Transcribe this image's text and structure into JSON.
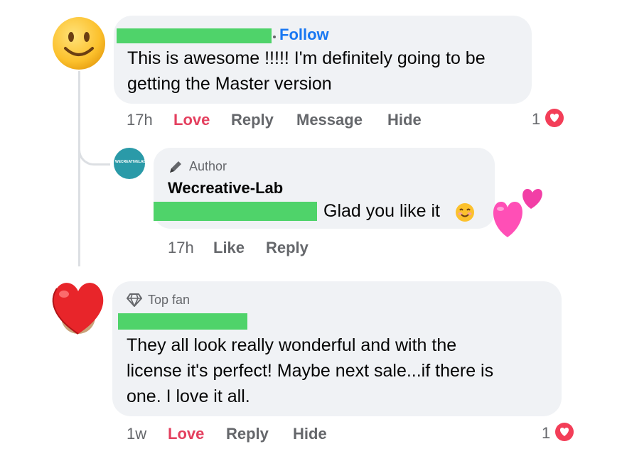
{
  "comment1": {
    "follow_label": "Follow",
    "text_line1": "This is awesome !!!!! I'm definitely going to be",
    "text_line2": "getting the Master version",
    "time": "17h",
    "love": "Love",
    "reply": "Reply",
    "message": "Message",
    "hide": "Hide",
    "reaction_count": "1"
  },
  "reply1": {
    "avatar_text": "WECREATIVELAB",
    "badge": "Author",
    "author": "Wecreative-Lab",
    "text": "Glad you like it",
    "time": "17h",
    "like": "Like",
    "reply": "Reply"
  },
  "comment2": {
    "badge": "Top fan",
    "text_line1": "They all look really wonderful and with the",
    "text_line2": "license it's perfect!  Maybe next sale...if there is",
    "text_line3": "one.  I love it all.",
    "time": "1w",
    "love": "Love",
    "reply": "Reply",
    "hide": "Hide",
    "reaction_count": "1"
  },
  "colors": {
    "bubble": "#f0f2f5",
    "love": "#e4405f",
    "follow": "#1877f2",
    "redaction": "#4fd36a",
    "muted": "#65676b"
  }
}
